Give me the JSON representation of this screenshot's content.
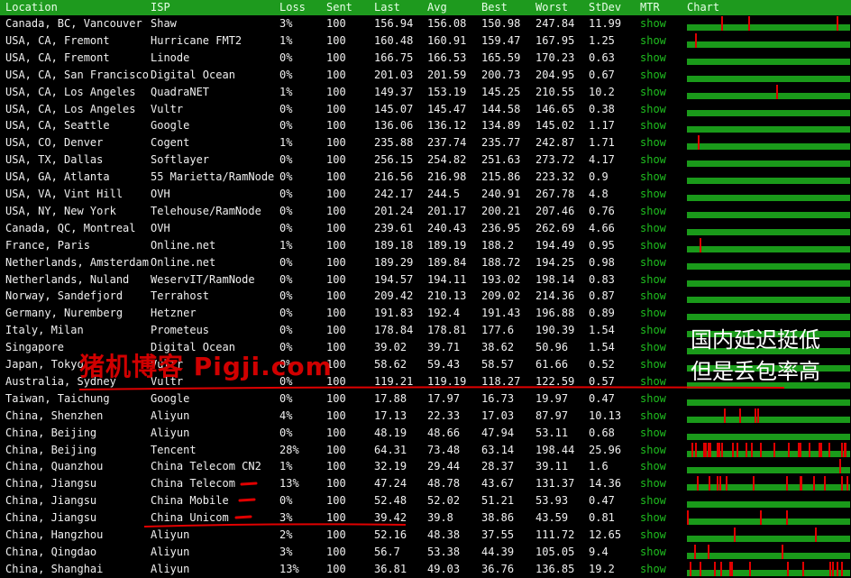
{
  "header": {
    "location": "Location",
    "isp": "ISP",
    "loss": "Loss",
    "sent": "Sent",
    "last": "Last",
    "avg": "Avg",
    "best": "Best",
    "worst": "Worst",
    "stdev": "StDev",
    "mtr": "MTR",
    "chart": "Chart"
  },
  "rows": [
    {
      "location": "Canada, BC, Vancouver",
      "isp": "Shaw",
      "loss": "3%",
      "sent": "100",
      "last": "156.94",
      "avg": "156.08",
      "best": "150.98",
      "worst": "247.84",
      "stdev": "11.99",
      "mtr": "show",
      "loss_rate": 0.03
    },
    {
      "location": "USA, CA, Fremont",
      "isp": "Hurricane FMT2",
      "loss": "1%",
      "sent": "100",
      "last": "160.48",
      "avg": "160.91",
      "best": "159.47",
      "worst": "167.95",
      "stdev": "1.25",
      "mtr": "show",
      "loss_rate": 0.01
    },
    {
      "location": "USA, CA, Fremont",
      "isp": "Linode",
      "loss": "0%",
      "sent": "100",
      "last": "166.75",
      "avg": "166.53",
      "best": "165.59",
      "worst": "170.23",
      "stdev": "0.63",
      "mtr": "show",
      "loss_rate": 0
    },
    {
      "location": "USA, CA, San Francisco",
      "isp": "Digital Ocean",
      "loss": "0%",
      "sent": "100",
      "last": "201.03",
      "avg": "201.59",
      "best": "200.73",
      "worst": "204.95",
      "stdev": "0.67",
      "mtr": "show",
      "loss_rate": 0
    },
    {
      "location": "USA, CA, Los Angeles",
      "isp": "QuadraNET",
      "loss": "1%",
      "sent": "100",
      "last": "149.37",
      "avg": "153.19",
      "best": "145.25",
      "worst": "210.55",
      "stdev": "10.2",
      "mtr": "show",
      "loss_rate": 0.01
    },
    {
      "location": "USA, CA, Los Angeles",
      "isp": "Vultr",
      "loss": "0%",
      "sent": "100",
      "last": "145.07",
      "avg": "145.47",
      "best": "144.58",
      "worst": "146.65",
      "stdev": "0.38",
      "mtr": "show",
      "loss_rate": 0
    },
    {
      "location": "USA, CA, Seattle",
      "isp": "Google",
      "loss": "0%",
      "sent": "100",
      "last": "136.06",
      "avg": "136.12",
      "best": "134.89",
      "worst": "145.02",
      "stdev": "1.17",
      "mtr": "show",
      "loss_rate": 0
    },
    {
      "location": "USA, CO, Denver",
      "isp": "Cogent",
      "loss": "1%",
      "sent": "100",
      "last": "235.88",
      "avg": "237.74",
      "best": "235.77",
      "worst": "242.87",
      "stdev": "1.71",
      "mtr": "show",
      "loss_rate": 0.01
    },
    {
      "location": "USA, TX, Dallas",
      "isp": "Softlayer",
      "loss": "0%",
      "sent": "100",
      "last": "256.15",
      "avg": "254.82",
      "best": "251.63",
      "worst": "273.72",
      "stdev": "4.17",
      "mtr": "show",
      "loss_rate": 0
    },
    {
      "location": "USA, GA, Atlanta",
      "isp": "55 Marietta/RamNode",
      "loss": "0%",
      "sent": "100",
      "last": "216.56",
      "avg": "216.98",
      "best": "215.86",
      "worst": "223.32",
      "stdev": "0.9",
      "mtr": "show",
      "loss_rate": 0
    },
    {
      "location": "USA, VA, Vint Hill",
      "isp": "OVH",
      "loss": "0%",
      "sent": "100",
      "last": "242.17",
      "avg": "244.5",
      "best": "240.91",
      "worst": "267.78",
      "stdev": "4.8",
      "mtr": "show",
      "loss_rate": 0
    },
    {
      "location": "USA, NY, New York",
      "isp": "Telehouse/RamNode",
      "loss": "0%",
      "sent": "100",
      "last": "201.24",
      "avg": "201.17",
      "best": "200.21",
      "worst": "207.46",
      "stdev": "0.76",
      "mtr": "show",
      "loss_rate": 0
    },
    {
      "location": "Canada, QC, Montreal",
      "isp": "OVH",
      "loss": "0%",
      "sent": "100",
      "last": "239.61",
      "avg": "240.43",
      "best": "236.95",
      "worst": "262.69",
      "stdev": "4.66",
      "mtr": "show",
      "loss_rate": 0
    },
    {
      "location": "France, Paris",
      "isp": "Online.net",
      "loss": "1%",
      "sent": "100",
      "last": "189.18",
      "avg": "189.19",
      "best": "188.2",
      "worst": "194.49",
      "stdev": "0.95",
      "mtr": "show",
      "loss_rate": 0.01
    },
    {
      "location": "Netherlands, Amsterdam",
      "isp": "Online.net",
      "loss": "0%",
      "sent": "100",
      "last": "189.29",
      "avg": "189.84",
      "best": "188.72",
      "worst": "194.25",
      "stdev": "0.98",
      "mtr": "show",
      "loss_rate": 0
    },
    {
      "location": "Netherlands, Nuland",
      "isp": "WeservIT/RamNode",
      "loss": "0%",
      "sent": "100",
      "last": "194.57",
      "avg": "194.11",
      "best": "193.02",
      "worst": "198.14",
      "stdev": "0.83",
      "mtr": "show",
      "loss_rate": 0
    },
    {
      "location": "Norway, Sandefjord",
      "isp": "Terrahost",
      "loss": "0%",
      "sent": "100",
      "last": "209.42",
      "avg": "210.13",
      "best": "209.02",
      "worst": "214.36",
      "stdev": "0.87",
      "mtr": "show",
      "loss_rate": 0
    },
    {
      "location": "Germany, Nuremberg",
      "isp": "Hetzner",
      "loss": "0%",
      "sent": "100",
      "last": "191.83",
      "avg": "192.4",
      "best": "191.43",
      "worst": "196.88",
      "stdev": "0.89",
      "mtr": "show",
      "loss_rate": 0
    },
    {
      "location": "Italy, Milan",
      "isp": "Prometeus",
      "loss": "0%",
      "sent": "100",
      "last": "178.84",
      "avg": "178.81",
      "best": "177.6",
      "worst": "190.39",
      "stdev": "1.54",
      "mtr": "show",
      "loss_rate": 0
    },
    {
      "location": "Singapore",
      "isp": "Digital Ocean",
      "loss": "0%",
      "sent": "100",
      "last": "39.02",
      "avg": "39.71",
      "best": "38.62",
      "worst": "50.96",
      "stdev": "1.54",
      "mtr": "show",
      "loss_rate": 0
    },
    {
      "location": "Japan, Tokyo",
      "isp": "Vultr",
      "loss": "0%",
      "sent": "100",
      "last": "58.62",
      "avg": "59.43",
      "best": "58.57",
      "worst": "61.66",
      "stdev": "0.52",
      "mtr": "show",
      "loss_rate": 0
    },
    {
      "location": "Australia, Sydney",
      "isp": "Vultr",
      "loss": "0%",
      "sent": "100",
      "last": "119.21",
      "avg": "119.19",
      "best": "118.27",
      "worst": "122.59",
      "stdev": "0.57",
      "mtr": "show",
      "loss_rate": 0
    },
    {
      "location": "Taiwan, Taichung",
      "isp": "Google",
      "loss": "0%",
      "sent": "100",
      "last": "17.88",
      "avg": "17.97",
      "best": "16.73",
      "worst": "19.97",
      "stdev": "0.47",
      "mtr": "show",
      "loss_rate": 0
    },
    {
      "location": "China, Shenzhen",
      "isp": "Aliyun",
      "loss": "4%",
      "sent": "100",
      "last": "17.13",
      "avg": "22.33",
      "best": "17.03",
      "worst": "87.97",
      "stdev": "10.13",
      "mtr": "show",
      "loss_rate": 0.04
    },
    {
      "location": "China, Beijing",
      "isp": "Aliyun",
      "loss": "0%",
      "sent": "100",
      "last": "48.19",
      "avg": "48.66",
      "best": "47.94",
      "worst": "53.11",
      "stdev": "0.68",
      "mtr": "show",
      "loss_rate": 0
    },
    {
      "location": "China, Beijing",
      "isp": "Tencent",
      "loss": "28%",
      "sent": "100",
      "last": "64.31",
      "avg": "73.48",
      "best": "63.14",
      "worst": "198.44",
      "stdev": "25.96",
      "mtr": "show",
      "loss_rate": 0.28
    },
    {
      "location": "China, Quanzhou",
      "isp": "China Telecom CN2",
      "loss": "1%",
      "sent": "100",
      "last": "32.19",
      "avg": "29.44",
      "best": "28.37",
      "worst": "39.11",
      "stdev": "1.6",
      "mtr": "show",
      "loss_rate": 0.01
    },
    {
      "location": "China, Jiangsu",
      "isp": "China Telecom",
      "loss": "13%",
      "sent": "100",
      "last": "47.24",
      "avg": "48.78",
      "best": "43.67",
      "worst": "131.37",
      "stdev": "14.36",
      "mtr": "show",
      "loss_rate": 0.13
    },
    {
      "location": "China, Jiangsu",
      "isp": "China Mobile",
      "loss": "0%",
      "sent": "100",
      "last": "52.48",
      "avg": "52.02",
      "best": "51.21",
      "worst": "53.93",
      "stdev": "0.47",
      "mtr": "show",
      "loss_rate": 0
    },
    {
      "location": "China, Jiangsu",
      "isp": "China Unicom",
      "loss": "3%",
      "sent": "100",
      "last": "39.42",
      "avg": "39.8",
      "best": "38.86",
      "worst": "43.59",
      "stdev": "0.81",
      "mtr": "show",
      "loss_rate": 0.03
    },
    {
      "location": "China, Hangzhou",
      "isp": "Aliyun",
      "loss": "2%",
      "sent": "100",
      "last": "52.16",
      "avg": "48.38",
      "best": "37.55",
      "worst": "111.72",
      "stdev": "12.65",
      "mtr": "show",
      "loss_rate": 0.02
    },
    {
      "location": "China, Qingdao",
      "isp": "Aliyun",
      "loss": "3%",
      "sent": "100",
      "last": "56.7",
      "avg": "53.38",
      "best": "44.39",
      "worst": "105.05",
      "stdev": "9.4",
      "mtr": "show",
      "loss_rate": 0.03
    },
    {
      "location": "China, Shanghai",
      "isp": "Aliyun",
      "loss": "13%",
      "sent": "100",
      "last": "36.81",
      "avg": "49.03",
      "best": "36.76",
      "worst": "136.85",
      "stdev": "19.2",
      "mtr": "show",
      "loss_rate": 0.13
    }
  ],
  "watermark": "猪机博客 Pigji.com",
  "annotation": [
    "国内延迟挺低",
    "但是丢包率高"
  ],
  "colors": {
    "header_bg": "#1e9a1e",
    "chart_green": "#1a9a1a",
    "loss_red": "#e00000",
    "show_link": "#1fbf1f",
    "annotation_red": "#e00000"
  }
}
